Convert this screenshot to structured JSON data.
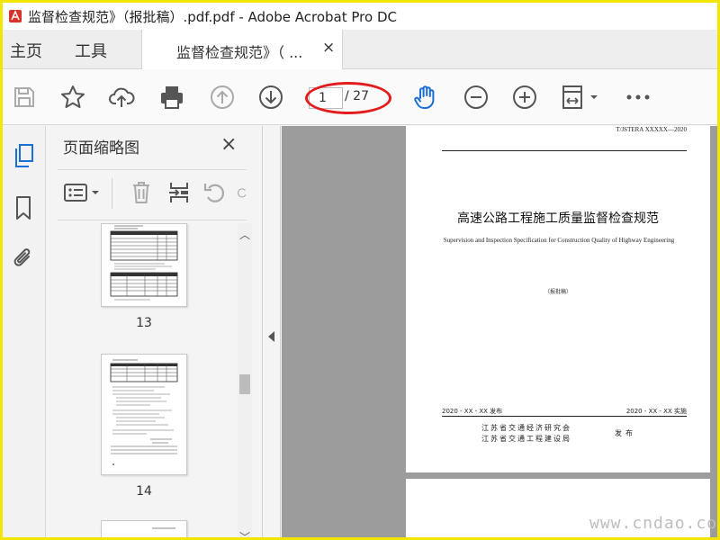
{
  "window": {
    "title": "监督检查规范》（报批稿）.pdf.pdf - Adobe Acrobat Pro DC"
  },
  "nav": {
    "home": "主页",
    "tools": "工具"
  },
  "tab": {
    "label": "监督检查规范》（ ...",
    "close": "×"
  },
  "toolbar": {
    "page_current": "1",
    "page_total": "/ 27"
  },
  "panel": {
    "title": "页面缩略图",
    "close": "×",
    "thumbnails": [
      {
        "page": "13"
      },
      {
        "page": "14"
      }
    ]
  },
  "document": {
    "std_number": "T/JSTERA XXXXX—2020",
    "title_cn": "高速公路工程施工质量监督检查规范",
    "title_en": "Supervision and Inspection Specification for Construction Quality of Highway Engineering",
    "stage": "（报批稿）",
    "issue_date": "2020 - XX - XX 发布",
    "impl_date": "2020 - XX - XX 实施",
    "publisher_1": "江苏省交通经济研究会",
    "publisher_2": "江苏省交通工程建设局",
    "issue_word": "发布"
  },
  "watermark": "www.cndao.com",
  "colors": {
    "accent_blue": "#1a6ed8",
    "highlight_red": "#e31b1b",
    "frame_yellow": "#f2e600"
  }
}
